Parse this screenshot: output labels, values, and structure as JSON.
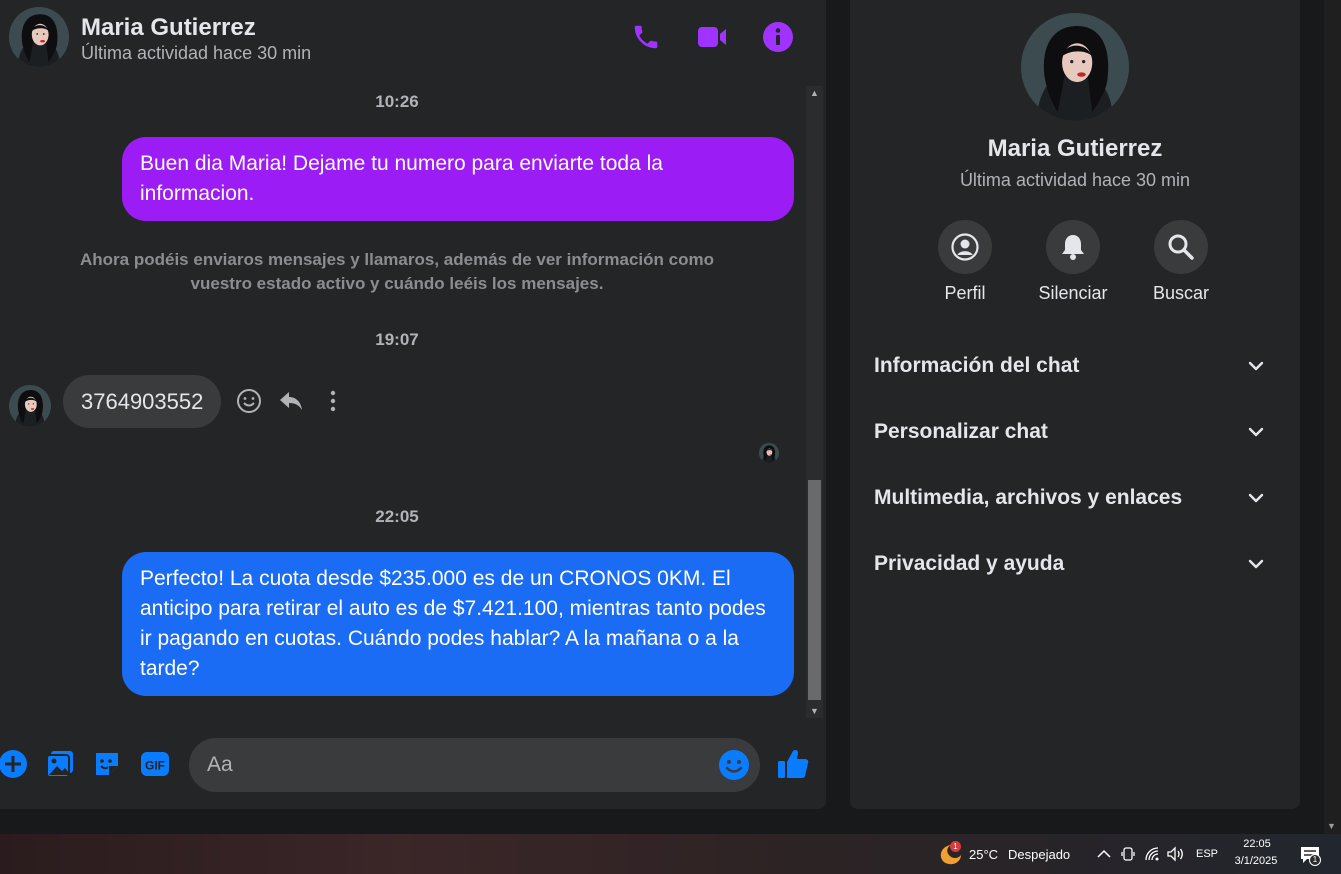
{
  "contact": {
    "name": "Maria Gutierrez",
    "status": "Última actividad hace 30 min"
  },
  "header_actions": [
    "phone-icon",
    "video-icon",
    "info-icon"
  ],
  "messages": {
    "time1": "10:26",
    "msg1": "Buen dia Maria! Dejame tu numero para enviarte toda la informacion.",
    "system_note": "Ahora podéis enviaros mensajes y llamaros, además de ver información como vuestro estado activo y cuándo leéis los mensajes.",
    "time2": "19:07",
    "incoming": "3764903552",
    "time3": "22:05",
    "msg2": "Perfecto! La cuota desde $235.000 es de un CRONOS 0KM. El anticipo para retirar el auto es de $7.421.100, mientras tanto podes ir pagando en cuotas. Cuándo podes hablar? A la mañana o a la tarde?"
  },
  "composer": {
    "placeholder": "Aa"
  },
  "info_panel": {
    "actions": [
      {
        "label": "Perfil",
        "icon": "profile-icon"
      },
      {
        "label": "Silenciar",
        "icon": "bell-icon"
      },
      {
        "label": "Buscar",
        "icon": "search-icon"
      }
    ],
    "sections": [
      "Información del chat",
      "Personalizar chat",
      "Multimedia, archivos y enlaces",
      "Privacidad y ayuda"
    ]
  },
  "taskbar": {
    "weather_temp": "25°C",
    "weather_desc": "Despejado",
    "weather_badge": "1",
    "language": "ESP",
    "time": "22:05",
    "date": "3/1/2025",
    "notification_count": "1"
  },
  "colors": {
    "accent_purple": "#a033ff",
    "bubble_purple": "#9b1cf4",
    "bubble_blue": "#1a6cf5",
    "composer_blue": "#0a7cff"
  }
}
